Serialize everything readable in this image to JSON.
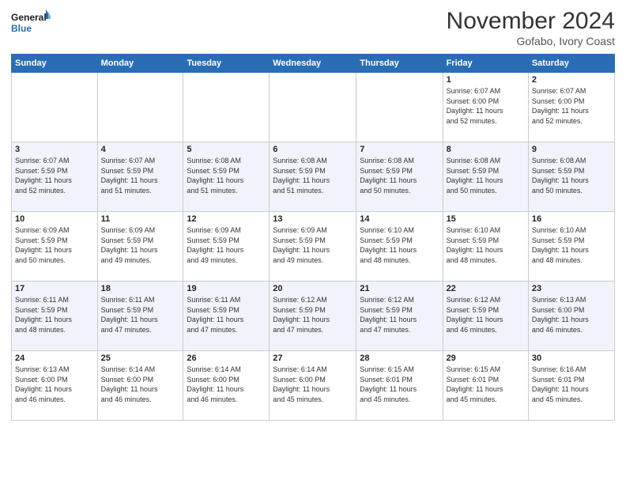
{
  "header": {
    "logo_line1": "General",
    "logo_line2": "Blue",
    "month": "November 2024",
    "location": "Gofabo, Ivory Coast"
  },
  "weekdays": [
    "Sunday",
    "Monday",
    "Tuesday",
    "Wednesday",
    "Thursday",
    "Friday",
    "Saturday"
  ],
  "weeks": [
    [
      {
        "day": "",
        "info": ""
      },
      {
        "day": "",
        "info": ""
      },
      {
        "day": "",
        "info": ""
      },
      {
        "day": "",
        "info": ""
      },
      {
        "day": "",
        "info": ""
      },
      {
        "day": "1",
        "info": "Sunrise: 6:07 AM\nSunset: 6:00 PM\nDaylight: 11 hours\nand 52 minutes."
      },
      {
        "day": "2",
        "info": "Sunrise: 6:07 AM\nSunset: 6:00 PM\nDaylight: 11 hours\nand 52 minutes."
      }
    ],
    [
      {
        "day": "3",
        "info": "Sunrise: 6:07 AM\nSunset: 5:59 PM\nDaylight: 11 hours\nand 52 minutes."
      },
      {
        "day": "4",
        "info": "Sunrise: 6:07 AM\nSunset: 5:59 PM\nDaylight: 11 hours\nand 51 minutes."
      },
      {
        "day": "5",
        "info": "Sunrise: 6:08 AM\nSunset: 5:59 PM\nDaylight: 11 hours\nand 51 minutes."
      },
      {
        "day": "6",
        "info": "Sunrise: 6:08 AM\nSunset: 5:59 PM\nDaylight: 11 hours\nand 51 minutes."
      },
      {
        "day": "7",
        "info": "Sunrise: 6:08 AM\nSunset: 5:59 PM\nDaylight: 11 hours\nand 50 minutes."
      },
      {
        "day": "8",
        "info": "Sunrise: 6:08 AM\nSunset: 5:59 PM\nDaylight: 11 hours\nand 50 minutes."
      },
      {
        "day": "9",
        "info": "Sunrise: 6:08 AM\nSunset: 5:59 PM\nDaylight: 11 hours\nand 50 minutes."
      }
    ],
    [
      {
        "day": "10",
        "info": "Sunrise: 6:09 AM\nSunset: 5:59 PM\nDaylight: 11 hours\nand 50 minutes."
      },
      {
        "day": "11",
        "info": "Sunrise: 6:09 AM\nSunset: 5:59 PM\nDaylight: 11 hours\nand 49 minutes."
      },
      {
        "day": "12",
        "info": "Sunrise: 6:09 AM\nSunset: 5:59 PM\nDaylight: 11 hours\nand 49 minutes."
      },
      {
        "day": "13",
        "info": "Sunrise: 6:09 AM\nSunset: 5:59 PM\nDaylight: 11 hours\nand 49 minutes."
      },
      {
        "day": "14",
        "info": "Sunrise: 6:10 AM\nSunset: 5:59 PM\nDaylight: 11 hours\nand 48 minutes."
      },
      {
        "day": "15",
        "info": "Sunrise: 6:10 AM\nSunset: 5:59 PM\nDaylight: 11 hours\nand 48 minutes."
      },
      {
        "day": "16",
        "info": "Sunrise: 6:10 AM\nSunset: 5:59 PM\nDaylight: 11 hours\nand 48 minutes."
      }
    ],
    [
      {
        "day": "17",
        "info": "Sunrise: 6:11 AM\nSunset: 5:59 PM\nDaylight: 11 hours\nand 48 minutes."
      },
      {
        "day": "18",
        "info": "Sunrise: 6:11 AM\nSunset: 5:59 PM\nDaylight: 11 hours\nand 47 minutes."
      },
      {
        "day": "19",
        "info": "Sunrise: 6:11 AM\nSunset: 5:59 PM\nDaylight: 11 hours\nand 47 minutes."
      },
      {
        "day": "20",
        "info": "Sunrise: 6:12 AM\nSunset: 5:59 PM\nDaylight: 11 hours\nand 47 minutes."
      },
      {
        "day": "21",
        "info": "Sunrise: 6:12 AM\nSunset: 5:59 PM\nDaylight: 11 hours\nand 47 minutes."
      },
      {
        "day": "22",
        "info": "Sunrise: 6:12 AM\nSunset: 5:59 PM\nDaylight: 11 hours\nand 46 minutes."
      },
      {
        "day": "23",
        "info": "Sunrise: 6:13 AM\nSunset: 6:00 PM\nDaylight: 11 hours\nand 46 minutes."
      }
    ],
    [
      {
        "day": "24",
        "info": "Sunrise: 6:13 AM\nSunset: 6:00 PM\nDaylight: 11 hours\nand 46 minutes."
      },
      {
        "day": "25",
        "info": "Sunrise: 6:14 AM\nSunset: 6:00 PM\nDaylight: 11 hours\nand 46 minutes."
      },
      {
        "day": "26",
        "info": "Sunrise: 6:14 AM\nSunset: 6:00 PM\nDaylight: 11 hours\nand 46 minutes."
      },
      {
        "day": "27",
        "info": "Sunrise: 6:14 AM\nSunset: 6:00 PM\nDaylight: 11 hours\nand 45 minutes."
      },
      {
        "day": "28",
        "info": "Sunrise: 6:15 AM\nSunset: 6:01 PM\nDaylight: 11 hours\nand 45 minutes."
      },
      {
        "day": "29",
        "info": "Sunrise: 6:15 AM\nSunset: 6:01 PM\nDaylight: 11 hours\nand 45 minutes."
      },
      {
        "day": "30",
        "info": "Sunrise: 6:16 AM\nSunset: 6:01 PM\nDaylight: 11 hours\nand 45 minutes."
      }
    ]
  ]
}
